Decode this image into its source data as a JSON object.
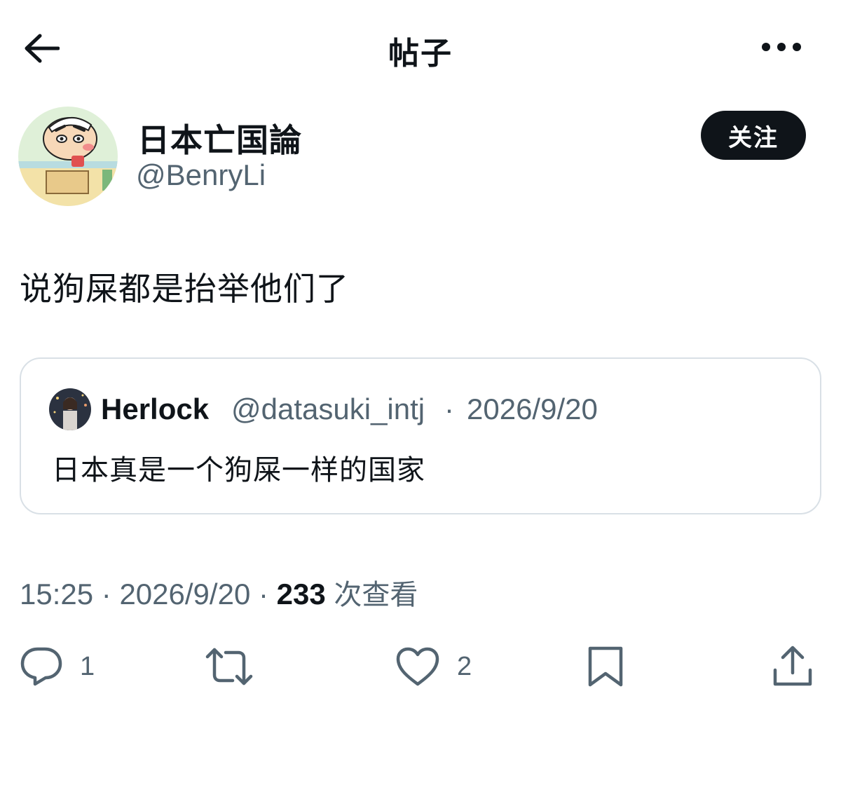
{
  "header": {
    "title": "帖子",
    "back_icon": "arrow-left-icon",
    "more_icon": "more-horizontal-icon"
  },
  "author": {
    "display_name": "日本亡国論",
    "handle": "@BenryLi",
    "follow_label": "关注"
  },
  "post": {
    "text": "说狗屎都是抬举他们了"
  },
  "quote": {
    "display_name": "Herlock",
    "handle": "@datasuki_intj",
    "separator": "·",
    "date": "2026/9/20",
    "text": "日本真是一个狗屎一样的国家"
  },
  "meta": {
    "time": "15:25",
    "separator": "·",
    "date": "2026/9/20",
    "views_count": "233",
    "views_label": "次查看"
  },
  "actions": {
    "reply": {
      "icon": "reply-icon",
      "count": "1"
    },
    "repost": {
      "icon": "repost-icon"
    },
    "like": {
      "icon": "heart-icon",
      "count": "2"
    },
    "bookmark": {
      "icon": "bookmark-icon"
    },
    "share": {
      "icon": "share-icon"
    }
  },
  "colors": {
    "text_primary": "#0f1419",
    "text_secondary": "#536471",
    "border": "#d9e0e6",
    "follow_bg": "#0f1419"
  }
}
